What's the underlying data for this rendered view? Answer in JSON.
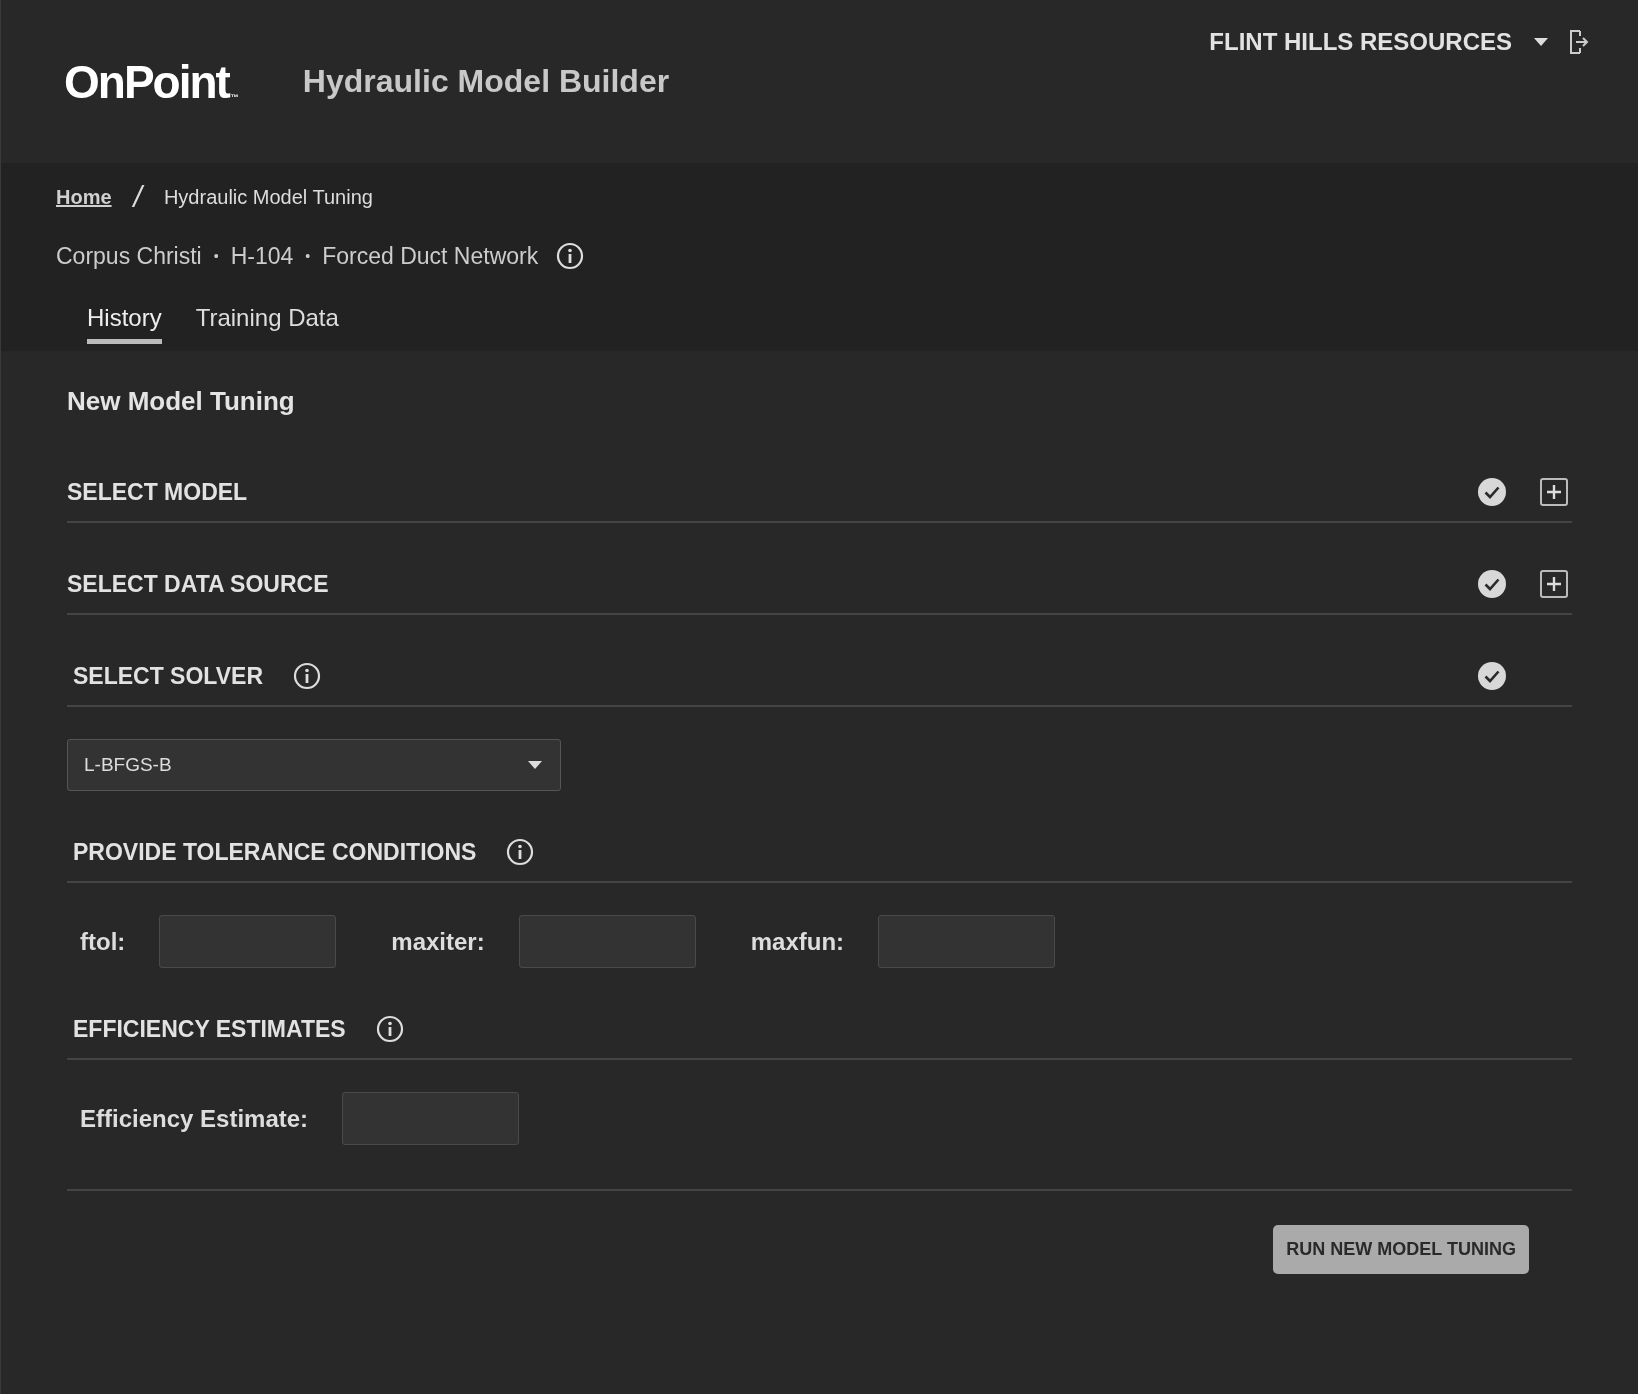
{
  "header": {
    "logo": "OnPoint",
    "logo_mark": "™",
    "app_title": "Hydraulic Model Builder",
    "account": {
      "name": "FLINT HILLS RESOURCES"
    }
  },
  "breadcrumb": [
    {
      "label": "Home",
      "kind": "link"
    },
    {
      "separator": "/",
      "label": "Hydraulic Model Tuning",
      "kind": "current"
    }
  ],
  "context": {
    "parts": [
      {
        "label": "Corpus Christi"
      },
      {
        "separator": "•",
        "label": "H-104"
      },
      {
        "separator": "•",
        "label": "Forced Duct Network"
      }
    ],
    "info": true
  },
  "tabs": [
    {
      "label": "History",
      "selected": true
    },
    {
      "label": "Training Data",
      "selected": false
    }
  ],
  "page_title": "New Model Tuning",
  "sections": [
    {
      "title": "SELECT MODEL",
      "info": false,
      "complete": true,
      "expandable": true,
      "kind": "plain"
    },
    {
      "title": "SELECT DATA SOURCE",
      "info": false,
      "complete": true,
      "expandable": true,
      "kind": "plain"
    },
    {
      "title": "SELECT SOLVER",
      "info": true,
      "complete": true,
      "expandable": false,
      "kind": "select",
      "value": "L-BFGS-B"
    },
    {
      "title": "PROVIDE TOLERANCE CONDITIONS",
      "info": true,
      "complete": false,
      "expandable": false,
      "kind": "fields",
      "fields": [
        {
          "label": "ftol:"
        },
        {
          "label": "maxiter:"
        },
        {
          "label": "maxfun:"
        }
      ]
    },
    {
      "title": "EFFICIENCY ESTIMATES",
      "info": true,
      "complete": false,
      "expandable": false,
      "kind": "fields",
      "fields": [
        {
          "label": "Efficiency Estimate:"
        }
      ]
    }
  ],
  "run_button": "RUN NEW MODEL TUNING"
}
